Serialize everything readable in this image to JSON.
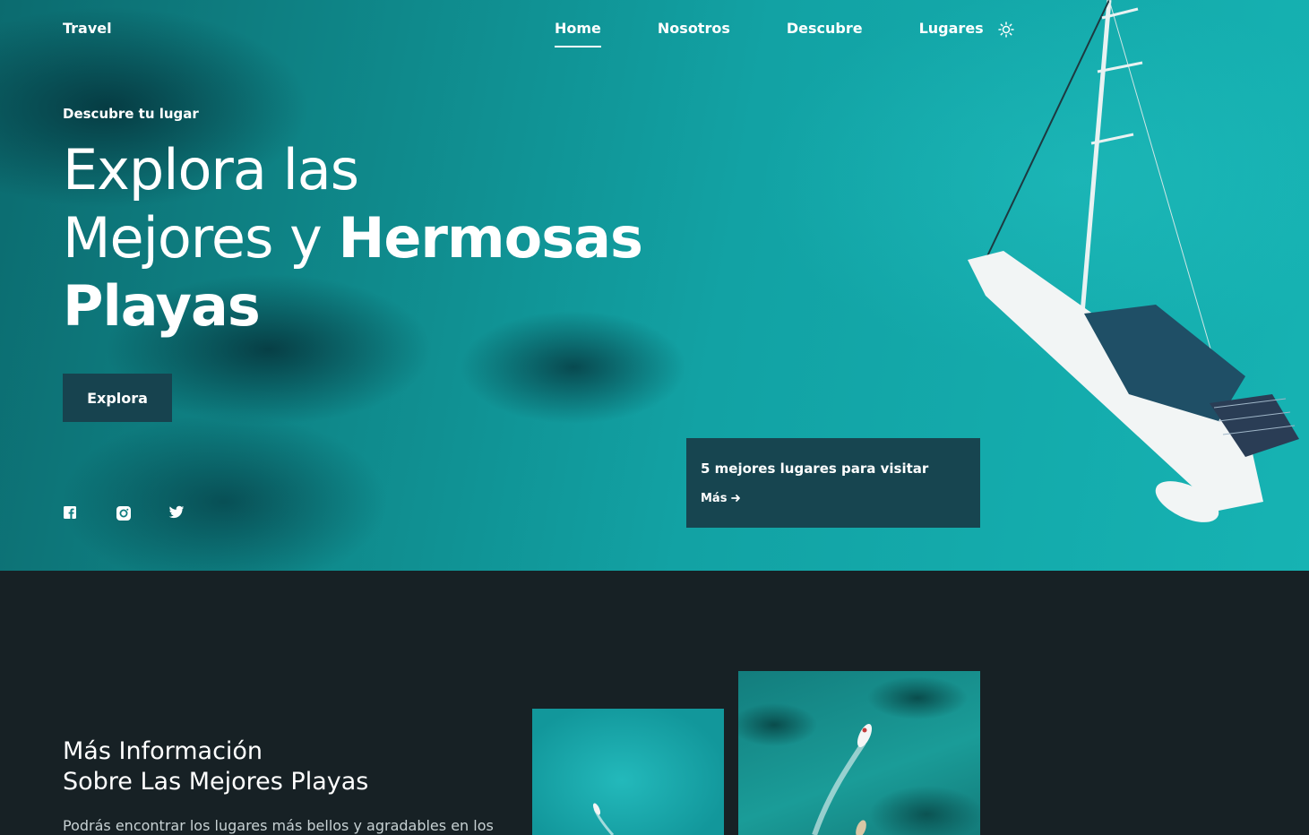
{
  "nav": {
    "logo": "Travel",
    "items": [
      {
        "label": "Home",
        "active": true
      },
      {
        "label": "Nosotros"
      },
      {
        "label": "Descubre"
      },
      {
        "label": "Lugares"
      }
    ],
    "theme_icon": "sun-icon"
  },
  "hero": {
    "subtitle": "Descubre tu lugar",
    "title_line1": "Explora las",
    "title_line2_light": "Mejores y ",
    "title_line2_bold": "Hermosas",
    "title_line3_bold": "Playas",
    "button_label": "Explora",
    "socials": [
      "facebook-icon",
      "instagram-icon",
      "twitter-icon"
    ]
  },
  "card": {
    "title": "5 mejores lugares para visitar",
    "link_label": "Más"
  },
  "info": {
    "title_line1": "Más Información",
    "title_line2": "Sobre Las Mejores Playas",
    "text": "Podrás encontrar los lugares más bellos y agradables en los"
  },
  "colors": {
    "button_bg": "#17434f",
    "card_bg": "#174550",
    "section_bg": "#172125"
  }
}
